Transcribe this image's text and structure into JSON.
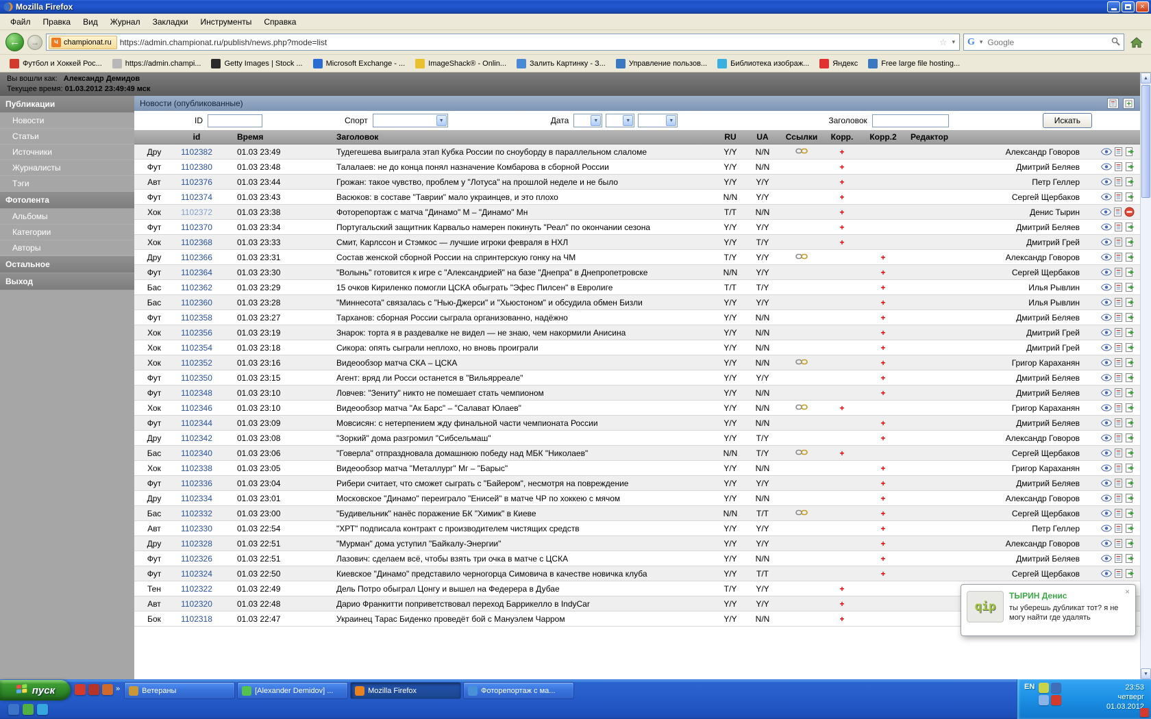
{
  "titlebar": {
    "title": "Mozilla Firefox"
  },
  "icons": {
    "close": "×",
    "back": "←",
    "forward": "→",
    "star": "☆",
    "dropdown_arrow": "▾",
    "select_arrow": "▼",
    "chevron": "»",
    "scroll_up": "▲",
    "scroll_down": "▼"
  },
  "menubar": {
    "items": [
      "Файл",
      "Правка",
      "Вид",
      "Журнал",
      "Закладки",
      "Инструменты",
      "Справка"
    ]
  },
  "navbar": {
    "site_identity": "championat.ru",
    "favicon_letter": "ч",
    "url": "https://admin.championat.ru/publish/news.php?mode=list",
    "search_placeholder": "Google",
    "search_engine_letter": "G"
  },
  "bookmarks": [
    {
      "label": "Футбол и Хоккей Рос...",
      "color": "#d23a2e"
    },
    {
      "label": "https://admin.champi...",
      "color": "#b8b8b8"
    },
    {
      "label": "Getty Images | Stock ...",
      "color": "#2a2a2a"
    },
    {
      "label": "Microsoft Exchange - ...",
      "color": "#2b6cd4"
    },
    {
      "label": "ImageShack® - Onlin...",
      "color": "#e8c030"
    },
    {
      "label": "Залить Картинку - З...",
      "color": "#4a8ad4"
    },
    {
      "label": "Управление пользов...",
      "color": "#3a78c2"
    },
    {
      "label": "Библиотека изображ...",
      "color": "#3ab0e0"
    },
    {
      "label": "Яндекс",
      "color": "#e03030"
    },
    {
      "label": "Free large file hosting...",
      "color": "#3a78c2"
    }
  ],
  "userbar": {
    "login_label": "Вы вошли как:",
    "login_name": "Александр Демидов",
    "time_label": "Текущее время:",
    "time_value": "01.03.2012 23:49:49 мск"
  },
  "sidebar": {
    "entries": [
      {
        "type": "header",
        "label": "Публикации"
      },
      {
        "type": "item",
        "label": "Новости"
      },
      {
        "type": "item",
        "label": "Статьи"
      },
      {
        "type": "item",
        "label": "Источники"
      },
      {
        "type": "item",
        "label": "Журналисты"
      },
      {
        "type": "item",
        "label": "Тэги"
      },
      {
        "type": "header",
        "label": "Фотолента"
      },
      {
        "type": "item",
        "label": "Альбомы"
      },
      {
        "type": "item",
        "label": "Категории"
      },
      {
        "type": "item",
        "label": "Авторы"
      },
      {
        "type": "header",
        "label": "Остальное"
      },
      {
        "type": "header",
        "label": "Выход"
      }
    ]
  },
  "main": {
    "title": "Новости (опубликованные)",
    "filters": {
      "id_label": "ID",
      "sport_label": "Спорт",
      "date_label": "Дата",
      "title_label": "Заголовок",
      "search_button": "Искать"
    },
    "table": {
      "headers": {
        "id": "id",
        "time": "Время",
        "title": "Заголовок",
        "ru": "RU",
        "ua": "UA",
        "links": "Ссылки",
        "korr": "Корр.",
        "korr2": "Корр.2",
        "editor": "Редактор"
      },
      "rows": [
        {
          "sport": "Дру",
          "id": "1102382",
          "time": "01.03 23:49",
          "title": "Тудегешева выиграла этап Кубка России по сноуборду в параллельном слаломе",
          "ru": "Y/Y",
          "ua": "N/N",
          "link": true,
          "korr": "+",
          "korr2": "",
          "editor": "Александр Говоров"
        },
        {
          "sport": "Фут",
          "id": "1102380",
          "time": "01.03 23:48",
          "title": "Талалаев: не до конца понял назначение Комбарова в сборной России",
          "ru": "Y/Y",
          "ua": "N/N",
          "korr": "+",
          "korr2": "",
          "editor": "Дмитрий Беляев"
        },
        {
          "sport": "Авт",
          "id": "1102376",
          "time": "01.03 23:44",
          "title": "Грожан: такое чувство, проблем у \"Лотуса\" на прошлой неделе и не было",
          "ru": "Y/Y",
          "ua": "Y/Y",
          "korr": "+",
          "korr2": "",
          "editor": "Петр Геллер"
        },
        {
          "sport": "Фут",
          "id": "1102374",
          "time": "01.03 23:43",
          "title": "Васюков: в составе \"Таврии\" мало украинцев, и это плохо",
          "ru": "N/N",
          "ua": "Y/Y",
          "korr": "+",
          "korr2": "",
          "editor": "Сергей Щербаков"
        },
        {
          "sport": "Хок",
          "id": "1102372",
          "time": "01.03 23:38",
          "title": "Фоторепортаж с матча \"Динамо\" М – \"Динамо\" Мн",
          "ru": "T/T",
          "ua": "N/N",
          "korr": "+",
          "korr2": "",
          "editor": "Денис Тырин",
          "blocked": true,
          "id_class": "visited"
        },
        {
          "sport": "Фут",
          "id": "1102370",
          "time": "01.03 23:34",
          "title": "Португальский защитник Карвальо намерен покинуть \"Реал\" по окончании сезона",
          "ru": "Y/Y",
          "ua": "Y/Y",
          "korr": "+",
          "korr2": "",
          "editor": "Дмитрий Беляев"
        },
        {
          "sport": "Хок",
          "id": "1102368",
          "time": "01.03 23:33",
          "title": "Смит, Карлссон и Стэмкос — лучшие игроки февраля в НХЛ",
          "ru": "Y/Y",
          "ua": "T/Y",
          "korr": "+",
          "korr2": "",
          "editor": "Дмитрий Грей"
        },
        {
          "sport": "Дру",
          "id": "1102366",
          "time": "01.03 23:31",
          "title": "Состав женской сборной России на спринтерскую гонку на ЧМ",
          "ru": "T/Y",
          "ua": "Y/Y",
          "link": true,
          "korr": "",
          "korr2": "+",
          "editor": "Александр Говоров"
        },
        {
          "sport": "Фут",
          "id": "1102364",
          "time": "01.03 23:30",
          "title": "\"Волынь\" готовится к игре с \"Александрией\" на базе \"Днепра\" в Днепропетровске",
          "ru": "N/N",
          "ua": "Y/Y",
          "korr": "",
          "korr2": "+",
          "editor": "Сергей Щербаков"
        },
        {
          "sport": "Бас",
          "id": "1102362",
          "time": "01.03 23:29",
          "title": "15 очков Кириленко помогли ЦСКА обыграть \"Эфес Пилсен\" в Евролиге",
          "ru": "T/T",
          "ua": "T/Y",
          "korr": "",
          "korr2": "+",
          "editor": "Илья Рывлин"
        },
        {
          "sport": "Бас",
          "id": "1102360",
          "time": "01.03 23:28",
          "title": "\"Миннесота\" связалась с \"Нью-Джерси\" и \"Хьюстоном\" и обсудила обмен Бизли",
          "ru": "Y/Y",
          "ua": "Y/Y",
          "korr": "",
          "korr2": "+",
          "editor": "Илья Рывлин"
        },
        {
          "sport": "Фут",
          "id": "1102358",
          "time": "01.03 23:27",
          "title": "Тарханов: сборная России сыграла организованно, надёжно",
          "ru": "Y/Y",
          "ua": "N/N",
          "korr": "",
          "korr2": "+",
          "editor": "Дмитрий Беляев"
        },
        {
          "sport": "Хок",
          "id": "1102356",
          "time": "01.03 23:19",
          "title": "Знарок: торта я в раздевалке не видел — не знаю, чем накормили Анисина",
          "ru": "Y/Y",
          "ua": "N/N",
          "korr": "",
          "korr2": "+",
          "editor": "Дмитрий Грей"
        },
        {
          "sport": "Хок",
          "id": "1102354",
          "time": "01.03 23:18",
          "title": "Сикора: опять сыграли неплохо, но вновь проиграли",
          "ru": "Y/Y",
          "ua": "N/N",
          "korr": "",
          "korr2": "+",
          "editor": "Дмитрий Грей"
        },
        {
          "sport": "Хок",
          "id": "1102352",
          "time": "01.03 23:16",
          "title": "Видеообзор матча СКА – ЦСКА",
          "ru": "Y/Y",
          "ua": "N/N",
          "link": true,
          "korr": "",
          "korr2": "+",
          "editor": "Григор Караханян"
        },
        {
          "sport": "Фут",
          "id": "1102350",
          "time": "01.03 23:15",
          "title": "Агент: вряд ли Росси останется в \"Вильярреале\"",
          "ru": "Y/Y",
          "ua": "Y/Y",
          "korr": "",
          "korr2": "+",
          "editor": "Дмитрий Беляев"
        },
        {
          "sport": "Фут",
          "id": "1102348",
          "time": "01.03 23:10",
          "title": "Ловчев: \"Зениту\" никто не помешает стать чемпионом",
          "ru": "Y/Y",
          "ua": "N/N",
          "korr": "",
          "korr2": "+",
          "editor": "Дмитрий Беляев"
        },
        {
          "sport": "Хок",
          "id": "1102346",
          "time": "01.03 23:10",
          "title": "Видеообзор матча \"Ак Барс\" – \"Салават Юлаев\"",
          "ru": "Y/Y",
          "ua": "N/N",
          "link": true,
          "korr": "+",
          "korr2": "",
          "editor": "Григор Караханян"
        },
        {
          "sport": "Фут",
          "id": "1102344",
          "time": "01.03 23:09",
          "title": "Мовсисян: с нетерпением жду финальной части чемпионата России",
          "ru": "Y/Y",
          "ua": "N/N",
          "korr": "",
          "korr2": "+",
          "editor": "Дмитрий Беляев"
        },
        {
          "sport": "Дру",
          "id": "1102342",
          "time": "01.03 23:08",
          "title": "\"Зоркий\" дома разгромил \"Сибсельмаш\"",
          "ru": "Y/Y",
          "ua": "T/Y",
          "korr": "",
          "korr2": "+",
          "editor": "Александр Говоров"
        },
        {
          "sport": "Бас",
          "id": "1102340",
          "time": "01.03 23:06",
          "title": "\"Говерла\" отпраздновала домашнюю победу над МБК \"Николаев\"",
          "ru": "N/N",
          "ua": "T/Y",
          "link": true,
          "korr": "+",
          "korr2": "",
          "editor": "Сергей Щербаков"
        },
        {
          "sport": "Хок",
          "id": "1102338",
          "time": "01.03 23:05",
          "title": "Видеообзор матча \"Металлург\" Мг – \"Барыс\"",
          "ru": "Y/Y",
          "ua": "N/N",
          "korr": "",
          "korr2": "+",
          "editor": "Григор Караханян"
        },
        {
          "sport": "Фут",
          "id": "1102336",
          "time": "01.03 23:04",
          "title": "Рибери считает, что сможет сыграть с \"Байером\", несмотря на повреждение",
          "ru": "Y/Y",
          "ua": "Y/Y",
          "korr": "",
          "korr2": "+",
          "editor": "Дмитрий Беляев"
        },
        {
          "sport": "Дру",
          "id": "1102334",
          "time": "01.03 23:01",
          "title": "Московское \"Динамо\" переиграло \"Енисей\" в матче ЧР по хоккею с мячом",
          "ru": "Y/Y",
          "ua": "N/N",
          "korr": "",
          "korr2": "+",
          "editor": "Александр Говоров"
        },
        {
          "sport": "Бас",
          "id": "1102332",
          "time": "01.03 23:00",
          "title": "\"Будивельник\" нанёс поражение БК \"Химик\" в Киеве",
          "ru": "N/N",
          "ua": "T/T",
          "link": true,
          "korr": "",
          "korr2": "+",
          "editor": "Сергей Щербаков"
        },
        {
          "sport": "Авт",
          "id": "1102330",
          "time": "01.03 22:54",
          "title": "\"ХРТ\" подписала контракт с производителем чистящих средств",
          "ru": "Y/Y",
          "ua": "Y/Y",
          "korr": "",
          "korr2": "+",
          "editor": "Петр Геллер"
        },
        {
          "sport": "Дру",
          "id": "1102328",
          "time": "01.03 22:51",
          "title": "\"Мурман\" дома уступил \"Байкалу-Энергии\"",
          "ru": "Y/Y",
          "ua": "Y/Y",
          "korr": "",
          "korr2": "+",
          "editor": "Александр Говоров"
        },
        {
          "sport": "Фут",
          "id": "1102326",
          "time": "01.03 22:51",
          "title": "Лазович: сделаем всё, чтобы взять три очка в матче с ЦСКА",
          "ru": "Y/Y",
          "ua": "N/N",
          "korr": "",
          "korr2": "+",
          "editor": "Дмитрий Беляев"
        },
        {
          "sport": "Фут",
          "id": "1102324",
          "time": "01.03 22:50",
          "title": "Киевское \"Динамо\" представило черногорца Симовича в качестве новичка клуба",
          "ru": "Y/Y",
          "ua": "T/T",
          "korr": "",
          "korr2": "+",
          "editor": "Сергей Щербаков"
        },
        {
          "sport": "Тен",
          "id": "1102322",
          "time": "01.03 22:49",
          "title": "Дель Потро обыграл Цонгу и вышел на Федерера в Дубае",
          "ru": "T/Y",
          "ua": "Y/Y",
          "korr": "+",
          "korr2": "",
          "editor": ""
        },
        {
          "sport": "Авт",
          "id": "1102320",
          "time": "01.03 22:48",
          "title": "Дарио Франкитти поприветствовал переход Баррикелло в IndyCar",
          "ru": "Y/Y",
          "ua": "Y/Y",
          "korr": "+",
          "korr2": "",
          "editor": ""
        },
        {
          "sport": "Бок",
          "id": "1102318",
          "time": "01.03 22:47",
          "title": "Украинец Тарас Биденко проведёт бой с Мануэлем Чарром",
          "ru": "Y/Y",
          "ua": "N/N",
          "korr": "+",
          "korr2": "",
          "editor": ""
        }
      ]
    }
  },
  "notification": {
    "title": "ТЫРИН Денис",
    "message": "ты уберешь дубликат тот? я не могу найти где удалять",
    "logo": "qip",
    "close": "×"
  },
  "taskbar": {
    "start": "пуск",
    "quick_launch_top": [
      {
        "name": "opera-icon",
        "color": "#d23a2e"
      },
      {
        "name": "filezilla-icon",
        "color": "#b5342a"
      },
      {
        "name": "mail-icon",
        "color": "#d06a2c"
      }
    ],
    "quick_launch_bottom": [
      {
        "name": "messenger-icon",
        "color": "#3b74c9"
      },
      {
        "name": "icq-icon",
        "color": "#52b043"
      },
      {
        "name": "skype-icon",
        "color": "#35a6e0"
      }
    ],
    "buttons": [
      {
        "label": "Ветераны",
        "color": "#c89838"
      },
      {
        "label": "[Alexander Demidov] ...",
        "color": "#55c14e"
      },
      {
        "label": "Mozilla Firefox",
        "color": "#e8821e",
        "state": "active"
      },
      {
        "label": "Фоторепортаж с ма...",
        "color": "#4a90d9"
      }
    ],
    "tray": {
      "lang": "EN",
      "clock_time": "23:53",
      "clock_day": "четверг",
      "clock_date": "01.03.2012",
      "icons": [
        {
          "name": "qip-tray-icon",
          "color": "#c7d34a"
        },
        {
          "name": "display-tray-icon",
          "color": "#3e6fb8"
        },
        {
          "name": "volume-tray-icon",
          "color": "#8ab4e8"
        },
        {
          "name": "antivirus-tray-icon",
          "color": "#d23a2e"
        }
      ]
    }
  }
}
